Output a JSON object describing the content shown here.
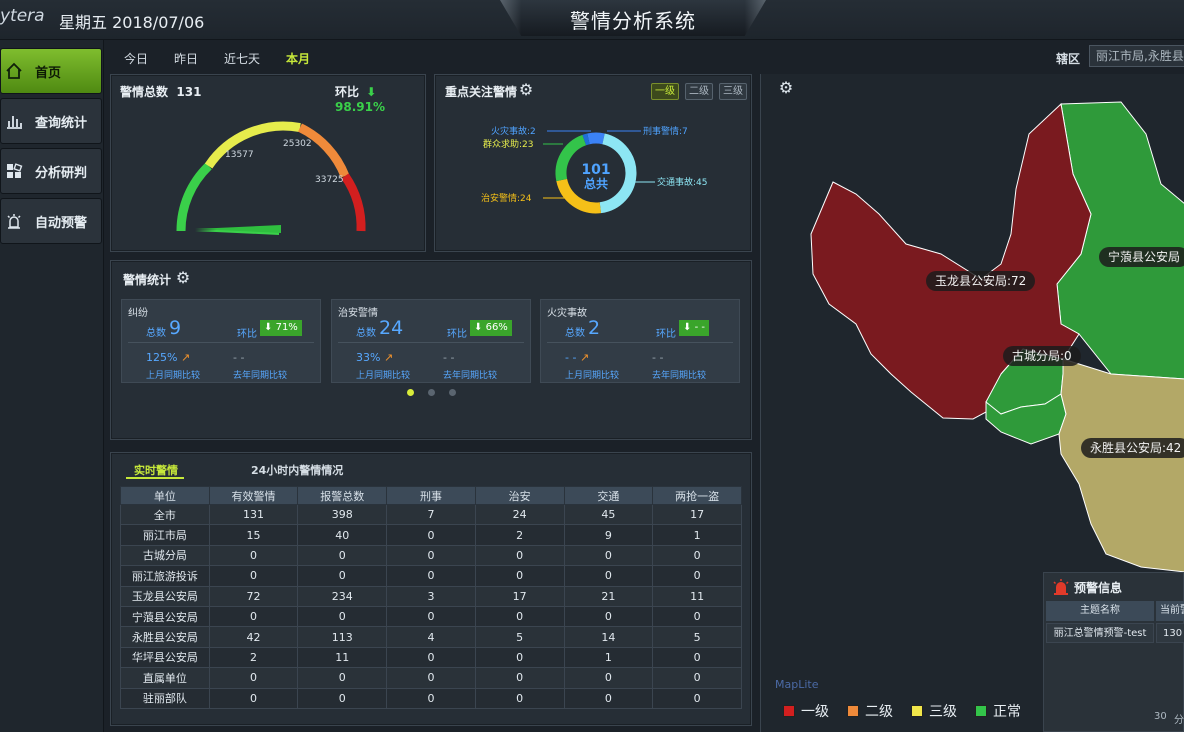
{
  "header": {
    "brand": "ytera",
    "datetime": "星期五 2018/07/06",
    "title": "警情分析系统"
  },
  "sidebar": {
    "items": [
      {
        "label": "首页",
        "icon": "home-icon",
        "active": true
      },
      {
        "label": "查询统计",
        "icon": "bar-chart-icon",
        "active": false
      },
      {
        "label": "分析研判",
        "icon": "grid-icon",
        "active": false
      },
      {
        "label": "自动预警",
        "icon": "alarm-icon",
        "active": false
      }
    ]
  },
  "filters": {
    "items": [
      "今日",
      "昨日",
      "近七天",
      "本月"
    ],
    "active": "本月",
    "region_label": "辖区",
    "region_value": "丽江市局,永胜县"
  },
  "gauge": {
    "title": "警情总数",
    "total": "131",
    "ring_label": "环比",
    "ring_value": "98.91%",
    "ticks": [
      "13577",
      "25302",
      "33725"
    ],
    "pointer_fraction": 0.0
  },
  "focus": {
    "title": "重点关注警情",
    "levels": [
      "一级",
      "二级",
      "三级"
    ],
    "active_level": "一级",
    "center_value": "101",
    "center_label": "总共",
    "labels": {
      "fire": "火灾事故:2",
      "crowd": "群众求助:23",
      "criminal": "刑事警情:7",
      "traffic": "交通事故:45",
      "security": "治安警情:24"
    },
    "slices": [
      {
        "name": "刑事警情",
        "value": 7,
        "color": "#3b82f6"
      },
      {
        "name": "交通事故",
        "value": 45,
        "color": "#8de6f4"
      },
      {
        "name": "治安警情",
        "value": 24,
        "color": "#f5c018"
      },
      {
        "name": "群众求助",
        "value": 23,
        "color": "#33c44a"
      },
      {
        "name": "火灾事故",
        "value": 2,
        "color": "#1f6fd6"
      }
    ]
  },
  "stats": {
    "title": "警情统计",
    "total_label": "总数",
    "ring_label": "环比",
    "month_label": "上月同期比较",
    "year_label": "去年同期比较",
    "cards": [
      {
        "name": "纠纷",
        "total": "9",
        "ring": "71%",
        "month": "125%",
        "year": "- -"
      },
      {
        "name": "治安警情",
        "total": "24",
        "ring": "66%",
        "month": "33%",
        "year": "- -"
      },
      {
        "name": "火灾事故",
        "total": "2",
        "ring": "- -",
        "month": "- -",
        "year": "- -"
      }
    ]
  },
  "realtime": {
    "tabs": [
      "实时警情",
      "24小时内警情情况"
    ],
    "columns": [
      "单位",
      "有效警情",
      "报警总数",
      "刑事",
      "治安",
      "交通",
      "两抢一盗"
    ],
    "rows": [
      [
        "全市",
        "131",
        "398",
        "7",
        "24",
        "45",
        "17"
      ],
      [
        "丽江市局",
        "15",
        "40",
        "0",
        "2",
        "9",
        "1"
      ],
      [
        "古城分局",
        "0",
        "0",
        "0",
        "0",
        "0",
        "0"
      ],
      [
        "丽江旅游投诉",
        "0",
        "0",
        "0",
        "0",
        "0",
        "0"
      ],
      [
        "玉龙县公安局",
        "72",
        "234",
        "3",
        "17",
        "21",
        "11"
      ],
      [
        "宁蒗县公安局",
        "0",
        "0",
        "0",
        "0",
        "0",
        "0"
      ],
      [
        "永胜县公安局",
        "42",
        "113",
        "4",
        "5",
        "14",
        "5"
      ],
      [
        "华坪县公安局",
        "2",
        "11",
        "0",
        "0",
        "1",
        "0"
      ],
      [
        "直属单位",
        "0",
        "0",
        "0",
        "0",
        "0",
        "0"
      ],
      [
        "驻丽部队",
        "0",
        "0",
        "0",
        "0",
        "0",
        "0"
      ]
    ]
  },
  "map": {
    "labels": {
      "yulong": "玉龙县公安局:72",
      "ninglang": "宁蒗县公安局",
      "gucheng": "古城分局:0",
      "yongsheng": "永胜县公安局:42"
    },
    "watermark": "MapLite",
    "colors": {
      "level1": "#7a1a1f",
      "level2": "#ef8a3a",
      "level3": "#f1e64a",
      "normal": "#2f9a3a",
      "tan": "#b3a867"
    },
    "legend": [
      {
        "label": "一级",
        "color": "#d31f1f"
      },
      {
        "label": "二级",
        "color": "#ef8a3a"
      },
      {
        "label": "三级",
        "color": "#f1e64a"
      },
      {
        "label": "正常",
        "color": "#33c44a"
      }
    ]
  },
  "warning": {
    "title": "预警信息",
    "col1": "主题名称",
    "col2": "当前警",
    "row_name": "丽江总警情预警-test",
    "row_value": "130",
    "page_size": "30",
    "page_unit": "分"
  }
}
